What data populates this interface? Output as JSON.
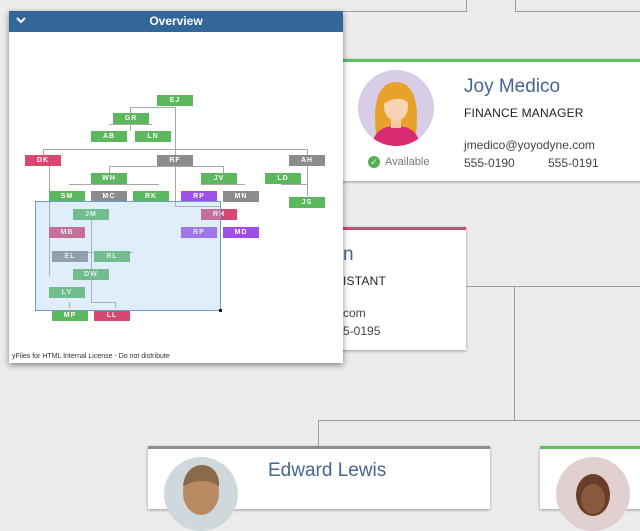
{
  "overview": {
    "title": "Overview",
    "footer": "yFiles for HTML Internal License - Do not distribute",
    "nodes": [
      {
        "id": "EJ",
        "color": "#5cb85c"
      },
      {
        "id": "GR",
        "color": "#5cb85c"
      },
      {
        "id": "AB",
        "color": "#5cb85c"
      },
      {
        "id": "LN",
        "color": "#5cb85c"
      },
      {
        "id": "DK",
        "color": "#d9466f"
      },
      {
        "id": "RF",
        "color": "#8c8c8c"
      },
      {
        "id": "AH",
        "color": "#8c8c8c"
      },
      {
        "id": "WH",
        "color": "#5cb85c"
      },
      {
        "id": "JV",
        "color": "#5cb85c"
      },
      {
        "id": "LD",
        "color": "#5cb85c"
      },
      {
        "id": "SM",
        "color": "#5cb85c"
      },
      {
        "id": "MC",
        "color": "#8c8c8c"
      },
      {
        "id": "RK",
        "color": "#5cb85c"
      },
      {
        "id": "RP",
        "color": "#a04ee8"
      },
      {
        "id": "MN",
        "color": "#8c8c8c"
      },
      {
        "id": "JS",
        "color": "#5cb85c"
      },
      {
        "id": "JM",
        "color": "#5cb85c"
      },
      {
        "id": "RH",
        "color": "#d9466f"
      },
      {
        "id": "MB",
        "color": "#d9466f"
      },
      {
        "id": "RP",
        "color": "#a04ee8"
      },
      {
        "id": "MD",
        "color": "#a04ee8"
      },
      {
        "id": "EL",
        "color": "#8c8c8c"
      },
      {
        "id": "RL",
        "color": "#5cb85c"
      },
      {
        "id": "DW",
        "color": "#5cb85c"
      },
      {
        "id": "LV",
        "color": "#5cb85c"
      },
      {
        "id": "MP",
        "color": "#5cb85c"
      },
      {
        "id": "LL",
        "color": "#d9466f"
      }
    ]
  },
  "cards": {
    "joy": {
      "name": "Joy Medico",
      "role": "FINANCE MANAGER",
      "email": "jmedico@yoyodyne.com",
      "phone": "555-0190",
      "fax": "555-0191",
      "status": "Available",
      "status_color": "#55b04f",
      "accent": "#5fbf5f"
    },
    "middle": {
      "name_fragment": "n",
      "role_fragment": "ISTANT",
      "email_fragment": "com",
      "phone_fragment": "5-0195",
      "accent": "#d9466f"
    },
    "edward": {
      "name": "Edward Lewis",
      "accent": "#8c8c8c"
    },
    "right": {
      "accent": "#5fbf5f"
    }
  }
}
